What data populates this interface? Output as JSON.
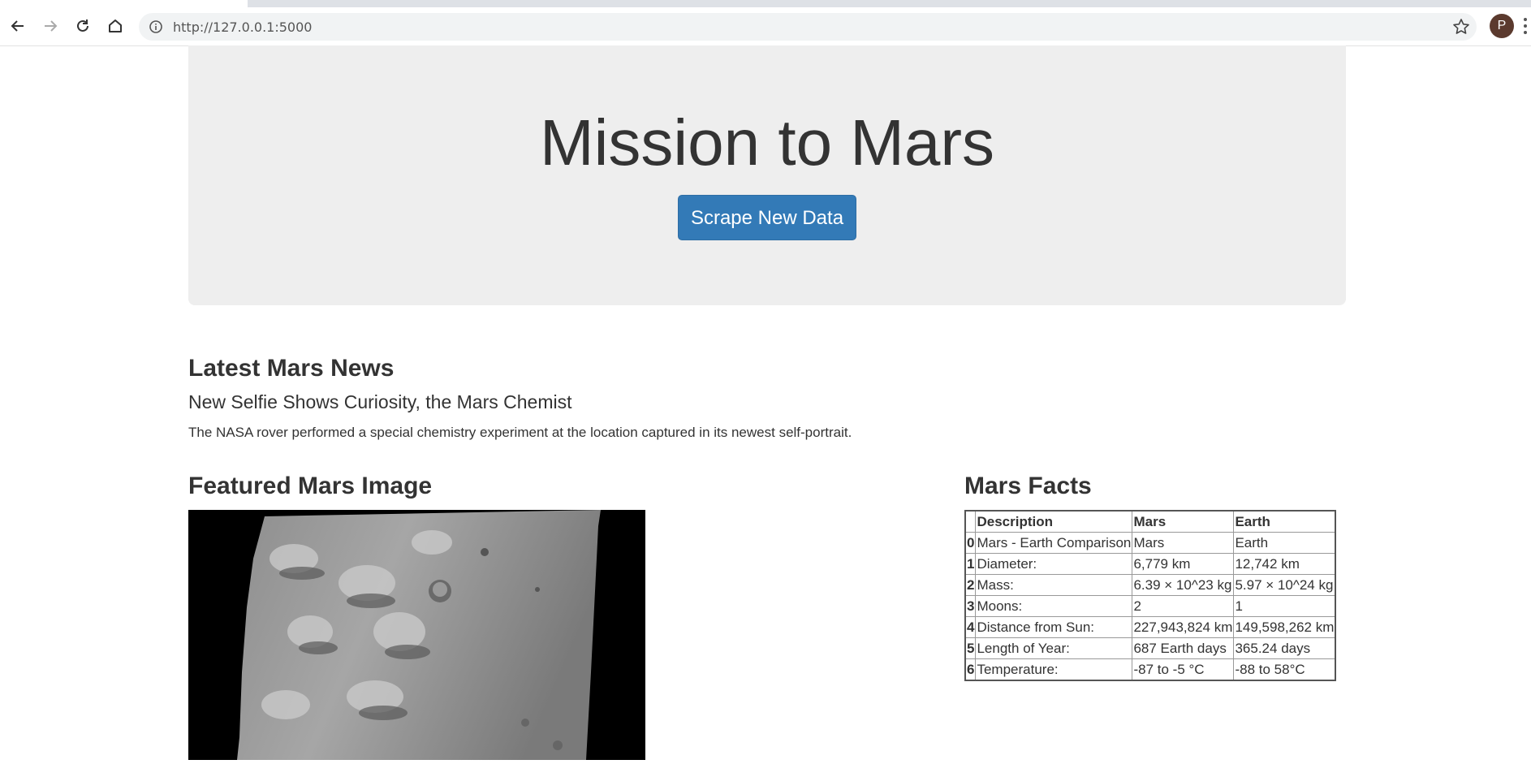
{
  "browser": {
    "url": "http://127.0.0.1:5000",
    "profile_initial": "P",
    "icons": {
      "back": "arrow-left-icon",
      "forward": "arrow-right-icon",
      "reload": "reload-icon",
      "home": "home-icon",
      "info": "info-icon",
      "bookmark": "star-icon",
      "menu": "more-vert-icon"
    }
  },
  "jumbotron": {
    "title": "Mission to Mars",
    "scrape_button": "Scrape New Data",
    "background": "#eeeeee",
    "button_color": "#337ab7"
  },
  "news": {
    "heading": "Latest Mars News",
    "title": "New Selfie Shows Curiosity, the Mars Chemist",
    "teaser": "The NASA rover performed a special chemistry experiment at the location captured in its newest self-portrait."
  },
  "featured_image": {
    "heading": "Featured Mars Image"
  },
  "facts": {
    "heading": "Mars Facts",
    "columns": [
      "",
      "Description",
      "Mars",
      "Earth"
    ],
    "rows": [
      [
        "0",
        "Mars - Earth Comparison",
        "Mars",
        "Earth"
      ],
      [
        "1",
        "Diameter:",
        "6,779 km",
        "12,742 km"
      ],
      [
        "2",
        "Mass:",
        "6.39 × 10^23 kg",
        "5.97 × 10^24 kg"
      ],
      [
        "3",
        "Moons:",
        "2",
        "1"
      ],
      [
        "4",
        "Distance from Sun:",
        "227,943,824 km",
        "149,598,262 km"
      ],
      [
        "5",
        "Length of Year:",
        "687 Earth days",
        "365.24 days"
      ],
      [
        "6",
        "Temperature:",
        "-87 to -5 °C",
        "-88 to 58°C"
      ]
    ]
  }
}
